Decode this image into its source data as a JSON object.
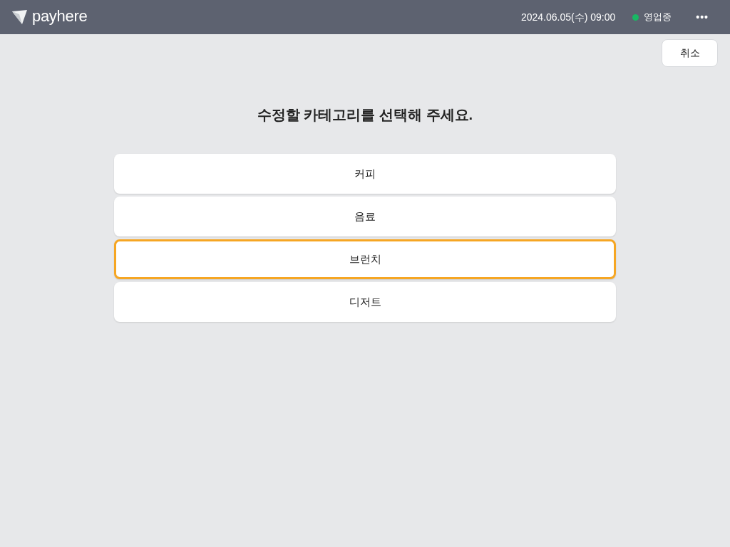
{
  "header": {
    "logo": "payhere",
    "datetime": "2024.06.05(수) 09:00",
    "status": "영업중",
    "more": "•••"
  },
  "cancel_button": "취소",
  "title": "수정할 카테고리를 선택해 주세요.",
  "categories": [
    {
      "label": "커피",
      "selected": false
    },
    {
      "label": "음료",
      "selected": false
    },
    {
      "label": "브런치",
      "selected": true
    },
    {
      "label": "디저트",
      "selected": false
    }
  ]
}
